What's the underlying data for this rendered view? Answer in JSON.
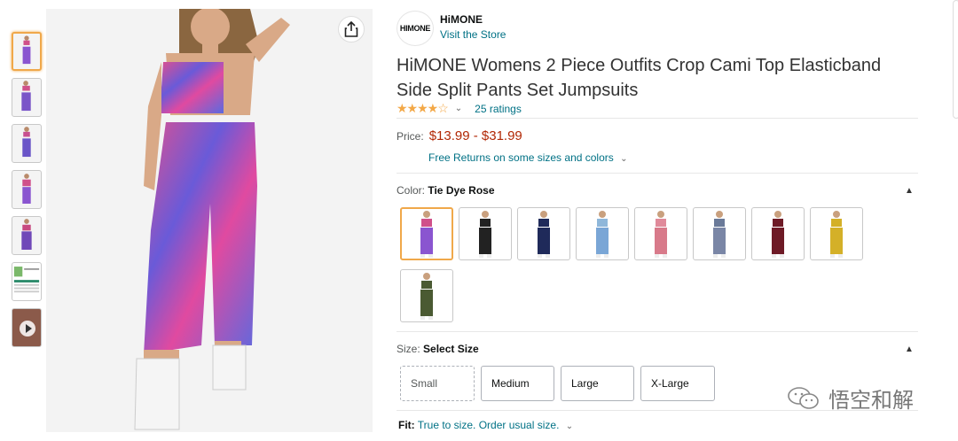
{
  "store": {
    "logo_text": "HIMONE",
    "brand": "HiMONE",
    "visit_link": "Visit the Store"
  },
  "product": {
    "title": "HiMONE Womens 2 Piece Outfits Crop Cami Top Elasticband Side Split Pants Set Jumpsuits",
    "stars_display": "★★★★☆",
    "rating": 4.2,
    "ratings_count_label": "25 ratings",
    "price_label": "Price:",
    "price_range": "$13.99 - $31.99",
    "returns_text": "Free Returns on some sizes and colors",
    "chevron": "⌄"
  },
  "color": {
    "label": "Color:",
    "selected": "Tie Dye Rose",
    "swatches": [
      {
        "name": "Tie Dye Rose",
        "top": "#d0508a",
        "pants": "#8a55d0"
      },
      {
        "name": "Black",
        "top": "#222222",
        "pants": "#222222"
      },
      {
        "name": "Navy",
        "top": "#1f2a5a",
        "pants": "#1f2a5a"
      },
      {
        "name": "Blue Tie Dye",
        "top": "#8fb7da",
        "pants": "#7aa6d6"
      },
      {
        "name": "Pink Tie Dye",
        "top": "#e08a9a",
        "pants": "#d87a8a"
      },
      {
        "name": "Grey Tie Dye",
        "top": "#6a7a99",
        "pants": "#7a86a6"
      },
      {
        "name": "Burgundy",
        "top": "#6e1a26",
        "pants": "#6e1a26"
      },
      {
        "name": "Yellow",
        "top": "#d4b028",
        "pants": "#d4b028"
      },
      {
        "name": "Olive",
        "top": "#4a5a32",
        "pants": "#4a5a32"
      }
    ]
  },
  "size": {
    "label": "Size:",
    "selected": "Select Size",
    "options": [
      "Small",
      "Medium",
      "Large",
      "X-Large"
    ]
  },
  "fit": {
    "label": "Fit:",
    "value": "True to size. Order usual size."
  },
  "watermark": {
    "text": "悟空和解"
  },
  "icons": {
    "share": "share-icon",
    "caret": "▲"
  }
}
